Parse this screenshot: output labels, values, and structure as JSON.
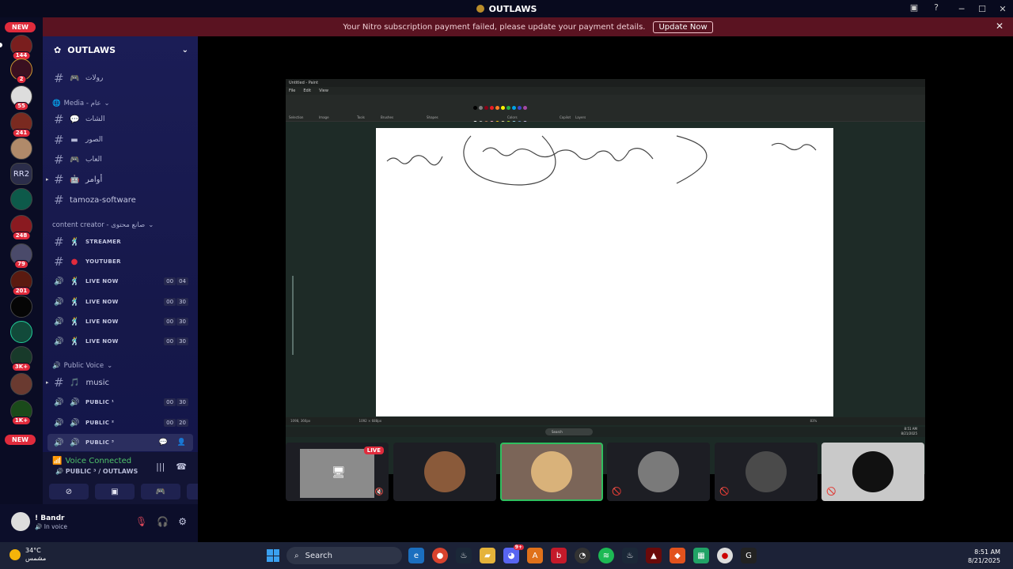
{
  "window": {
    "title": "OUTLAWS"
  },
  "notice": {
    "text": "Your Nitro subscription payment failed, please update your payment details.",
    "button": "Update Now"
  },
  "rail": {
    "badges": [
      "144",
      "2",
      "55",
      "241",
      "248",
      "79",
      "201",
      "3K+",
      "1K+"
    ],
    "new_label": "NEW",
    "rr2_label": "RR2"
  },
  "guild": {
    "name": "OUTLAWS"
  },
  "channels": {
    "rules": "رولات",
    "cat_media": "Media - عام",
    "chat": "الشات",
    "photos": "الصور",
    "games": "العاب",
    "commands": "أوامر",
    "tamoza": "tamoza-software",
    "cat_creator": "content creator - صانع محتوى",
    "streamer": "STREAMER",
    "youtuber": "YOUTUBER",
    "live_now": "LIVE NOW",
    "live1_count": [
      "00",
      "04"
    ],
    "live2_count": [
      "00",
      "30"
    ],
    "live3_count": [
      "00",
      "30"
    ],
    "live4_count": [
      "00",
      "30"
    ],
    "cat_public": "Public Voice",
    "music": "music",
    "public1": "PUBLIC ¹",
    "public2": "PUBLIC ²",
    "public3": "PUBLIC ³",
    "public1_count": [
      "00",
      "30"
    ],
    "public2_count": [
      "00",
      "20"
    ]
  },
  "voice": {
    "status": "Voice Connected",
    "channel": "PUBLIC ³ / OUTLAWS"
  },
  "user": {
    "name": "! Bandr",
    "status": "In voice"
  },
  "paint": {
    "title": "Untitled - Paint",
    "menu": [
      "File",
      "Edit",
      "View"
    ],
    "groups": [
      "Selection",
      "Image",
      "Tools",
      "Brushes",
      "Shapes",
      "Colors",
      "Copilot",
      "Layers"
    ],
    "colors": [
      "#000000",
      "#7f7f7f",
      "#880015",
      "#ed1c24",
      "#ff7f27",
      "#fff200",
      "#22b14c",
      "#00a2e8",
      "#3f48cc",
      "#a349a4",
      "#ffffff",
      "#c3c3c3",
      "#b97a57",
      "#ffaec9",
      "#ffc90e",
      "#efe4b0",
      "#b5e61d",
      "#99d9ea",
      "#7092be",
      "#c8bfe7"
    ],
    "status_left": "1098, 366px",
    "status_mid": "1092 × 688px",
    "zoom": "83%",
    "inner_search": "Search",
    "inner_time": "8:51 AM",
    "inner_date": "8/21/2025"
  },
  "tiles": {
    "live": "LIVE"
  },
  "taskbar": {
    "temp": "34°C",
    "weather": "مشمس",
    "search": "Search",
    "time": "8:51 AM",
    "date": "8/21/2025",
    "discord_badge": "9+"
  }
}
